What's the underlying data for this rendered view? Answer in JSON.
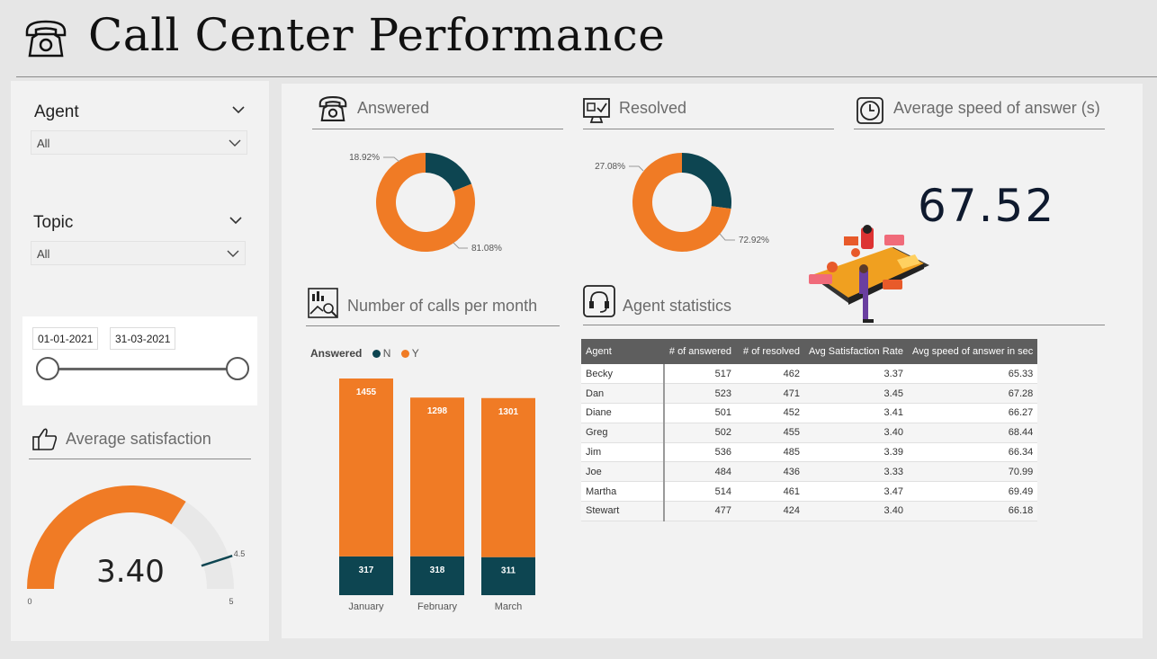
{
  "header": {
    "title": "Call Center Performance",
    "icon": "telephone-icon"
  },
  "filters": {
    "agent": {
      "label": "Agent",
      "value": "All"
    },
    "topic": {
      "label": "Topic",
      "value": "All"
    },
    "date_range": {
      "start": "01-01-2021",
      "end": "31-03-2021"
    }
  },
  "cards": {
    "answered": {
      "title": "Answered",
      "icon": "telephone-icon",
      "slices": [
        {
          "label": "18.92%",
          "value": 18.92,
          "color": "#0d4551"
        },
        {
          "label": "81.08%",
          "value": 81.08,
          "color": "#f07b25"
        }
      ]
    },
    "resolved": {
      "title": "Resolved",
      "icon": "monitor-check-icon",
      "slices": [
        {
          "label": "27.08%",
          "value": 27.08,
          "color": "#0d4551"
        },
        {
          "label": "72.92%",
          "value": 72.92,
          "color": "#f07b25"
        }
      ]
    },
    "avg_speed": {
      "title": "Average speed of answer (s)",
      "icon": "clock-icon",
      "value": "67.52"
    },
    "calls_per_month": {
      "title": "Number of calls per month",
      "icon": "chart-magnifier-icon"
    },
    "agent_stats": {
      "title": "Agent statistics",
      "icon": "headset-icon"
    },
    "avg_satisfaction": {
      "title": "Average satisfaction",
      "icon": "thumbs-up-icon",
      "value": "3.40",
      "value_num": 3.4,
      "min": "0",
      "max": "5",
      "target": "4.5",
      "target_num": 4.5
    }
  },
  "legend": {
    "title": "Answered",
    "items": [
      {
        "label": "N",
        "color": "#0d4551"
      },
      {
        "label": "Y",
        "color": "#f07b25"
      }
    ]
  },
  "chart_data": {
    "type": "bar",
    "stacked": true,
    "categories": [
      "January",
      "February",
      "March"
    ],
    "series": [
      {
        "name": "N",
        "values": [
          317,
          318,
          311
        ],
        "color": "#0d4551"
      },
      {
        "name": "Y",
        "values": [
          1455,
          1298,
          1301
        ],
        "color": "#f07b25"
      }
    ],
    "legend_title": "Answered",
    "grid": false
  },
  "table": {
    "columns": [
      "Agent",
      "# of answered",
      "# of resolved",
      "Avg Satisfaction Rate",
      "Avg speed of answer in sec"
    ],
    "rows": [
      [
        "Becky",
        "517",
        "462",
        "3.37",
        "65.33"
      ],
      [
        "Dan",
        "523",
        "471",
        "3.45",
        "67.28"
      ],
      [
        "Diane",
        "501",
        "452",
        "3.41",
        "66.27"
      ],
      [
        "Greg",
        "502",
        "455",
        "3.40",
        "68.44"
      ],
      [
        "Jim",
        "536",
        "485",
        "3.39",
        "66.34"
      ],
      [
        "Joe",
        "484",
        "436",
        "3.33",
        "70.99"
      ],
      [
        "Martha",
        "514",
        "461",
        "3.47",
        "69.49"
      ],
      [
        "Stewart",
        "477",
        "424",
        "3.40",
        "66.18"
      ]
    ]
  },
  "colors": {
    "accent": "#f07b25",
    "dark": "#0d4551",
    "gauge_bg": "#e8e8e8"
  }
}
